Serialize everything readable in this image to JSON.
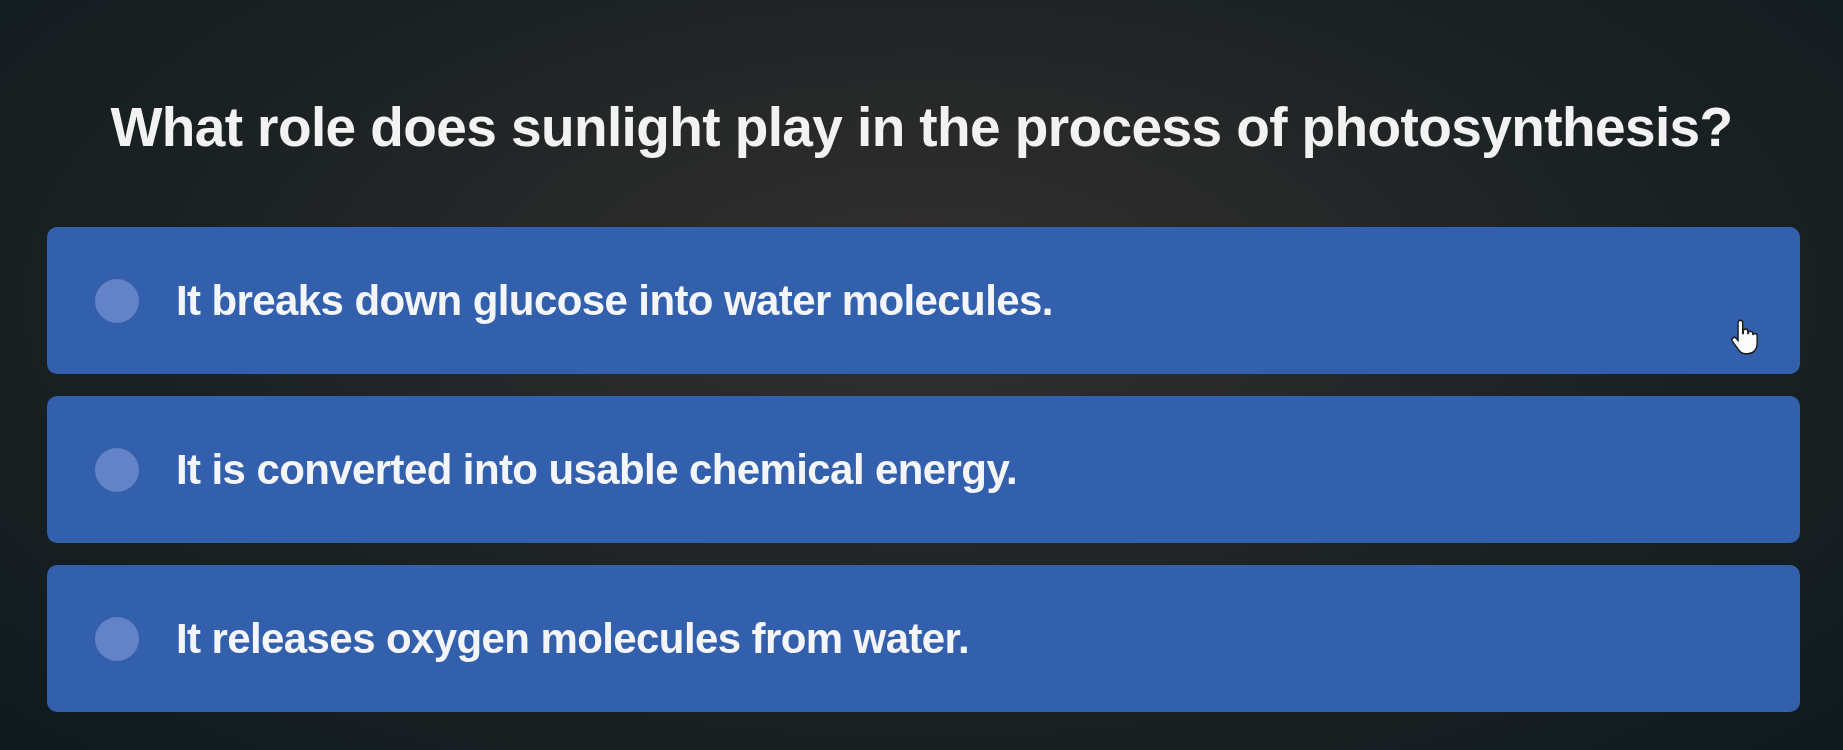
{
  "question": "What role does sunlight play in the process of photosynthesis?",
  "options": [
    {
      "text": "It breaks down glucose into water molecules.",
      "selected": false
    },
    {
      "text": "It is converted into usable chemical energy.",
      "selected": false
    },
    {
      "text": "It releases oxygen molecules from water.",
      "selected": false
    }
  ]
}
